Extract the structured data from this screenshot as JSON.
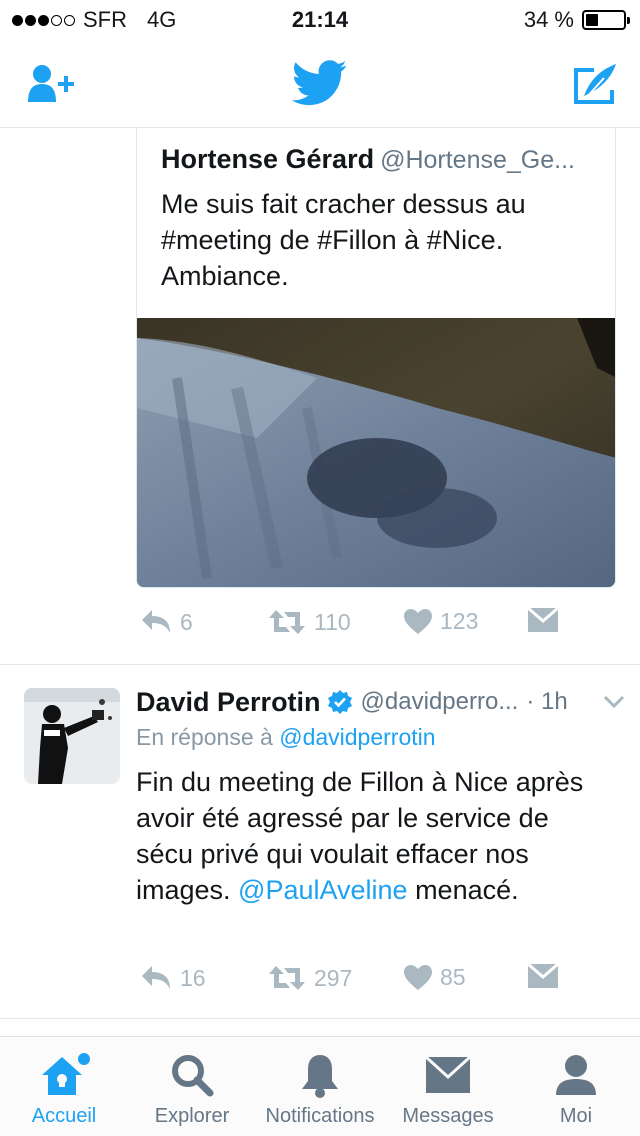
{
  "status_bar": {
    "signal_filled": 3,
    "signal_total": 5,
    "carrier": "SFR",
    "network": "4G",
    "time": "21:14",
    "battery_text": "34 %",
    "battery_level": 0.34
  },
  "nav": {
    "add_user_icon": "add-user-icon",
    "logo_icon": "twitter-bird-icon",
    "compose_icon": "compose-tweet-icon",
    "accent_color": "#1da1f2"
  },
  "quoted_tweet": {
    "name": "Hortense Gérard",
    "handle": "@Hortense_Ge...",
    "text": "Me suis fait cracher dessus au #meeting de #Fillon à #Nice. Ambiance.",
    "media": "photo"
  },
  "tweet1_actions": {
    "reply_count": "6",
    "retweet_count": "110",
    "like_count": "123"
  },
  "tweet2": {
    "name": "David Perrotin",
    "verified": true,
    "handle": "@davidperro...",
    "time": "· 1h",
    "reply_prefix": "En réponse à",
    "reply_mention": "@davidperrotin",
    "text_before_link": "Fin du meeting de Fillon à Nice après avoir été agressé par le service de sécu privé qui voulait effacer nos images. ",
    "link": "@PaulAveline",
    "text_after_link": " menacé.",
    "reply_count": "16",
    "retweet_count": "297",
    "like_count": "85"
  },
  "tabs": [
    {
      "label": "Accueil",
      "icon": "home-icon",
      "active": true,
      "badge": true
    },
    {
      "label": "Explorer",
      "icon": "search-icon",
      "active": false
    },
    {
      "label": "Notifications",
      "icon": "bell-icon",
      "active": false
    },
    {
      "label": "Messages",
      "icon": "envelope-icon",
      "active": false
    },
    {
      "label": "Moi",
      "icon": "profile-icon",
      "active": false
    }
  ]
}
